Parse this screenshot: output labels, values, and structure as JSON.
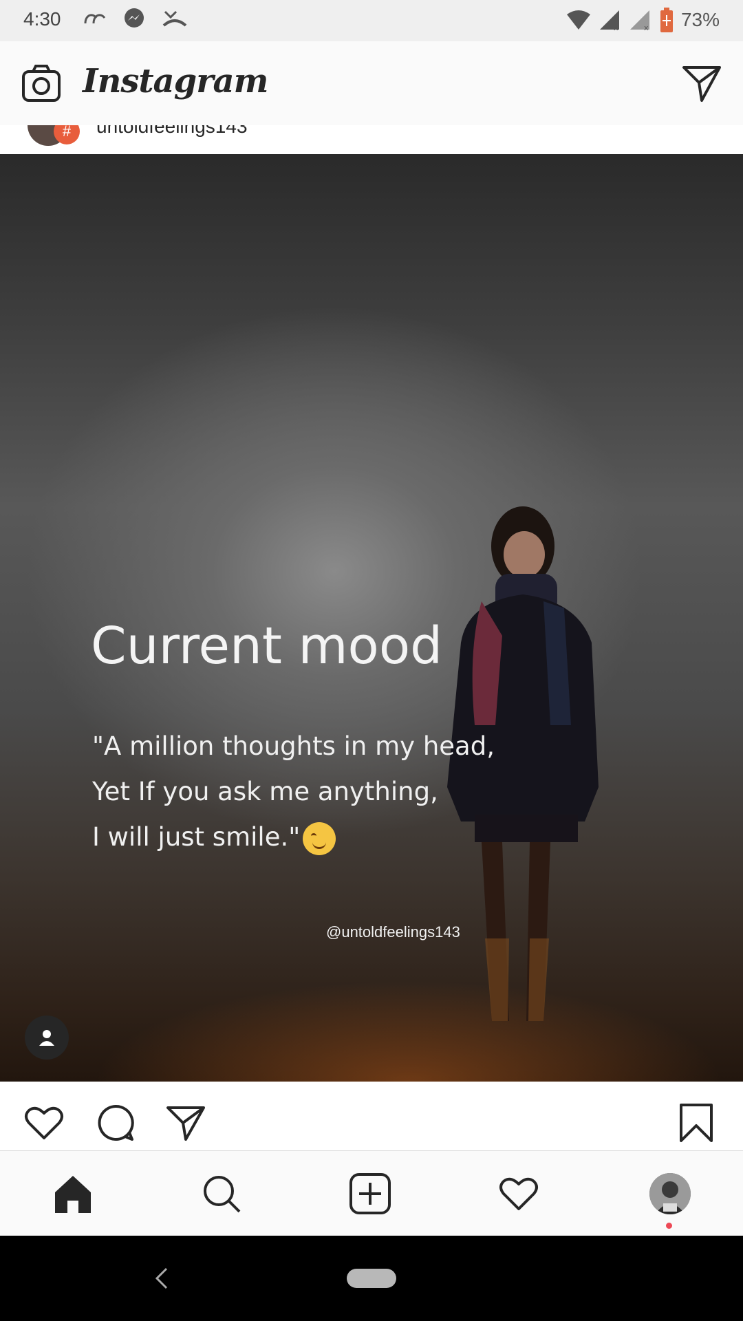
{
  "status_bar": {
    "time": "4:30",
    "battery_text": "73%",
    "icons": [
      "call-forward-icon",
      "messenger-icon",
      "missed-call-icon",
      "wifi-icon",
      "signal-icon",
      "signal-icon",
      "battery-icon"
    ]
  },
  "header": {
    "logo_text": "Instagram",
    "camera_icon": "camera-icon",
    "direct_icon": "direct-message-icon"
  },
  "post": {
    "username": "untoldfeelings143",
    "title": "Current mood",
    "quote_lines": [
      "\"A million thoughts in my head,",
      " Yet If you ask me anything,",
      " I will just smile.\""
    ],
    "watermark": "@untoldfeelings143"
  },
  "actions": {
    "like_icon": "heart-icon",
    "comment_icon": "comment-icon",
    "share_icon": "share-icon",
    "save_icon": "bookmark-icon"
  },
  "bottom_nav": {
    "items": [
      "home-icon",
      "search-icon",
      "add-post-icon",
      "activity-heart-icon",
      "profile-avatar"
    ]
  },
  "colors": {
    "notification_dot": "#ed4956",
    "header_bg": "#fafafa",
    "text_dark": "#262626"
  }
}
